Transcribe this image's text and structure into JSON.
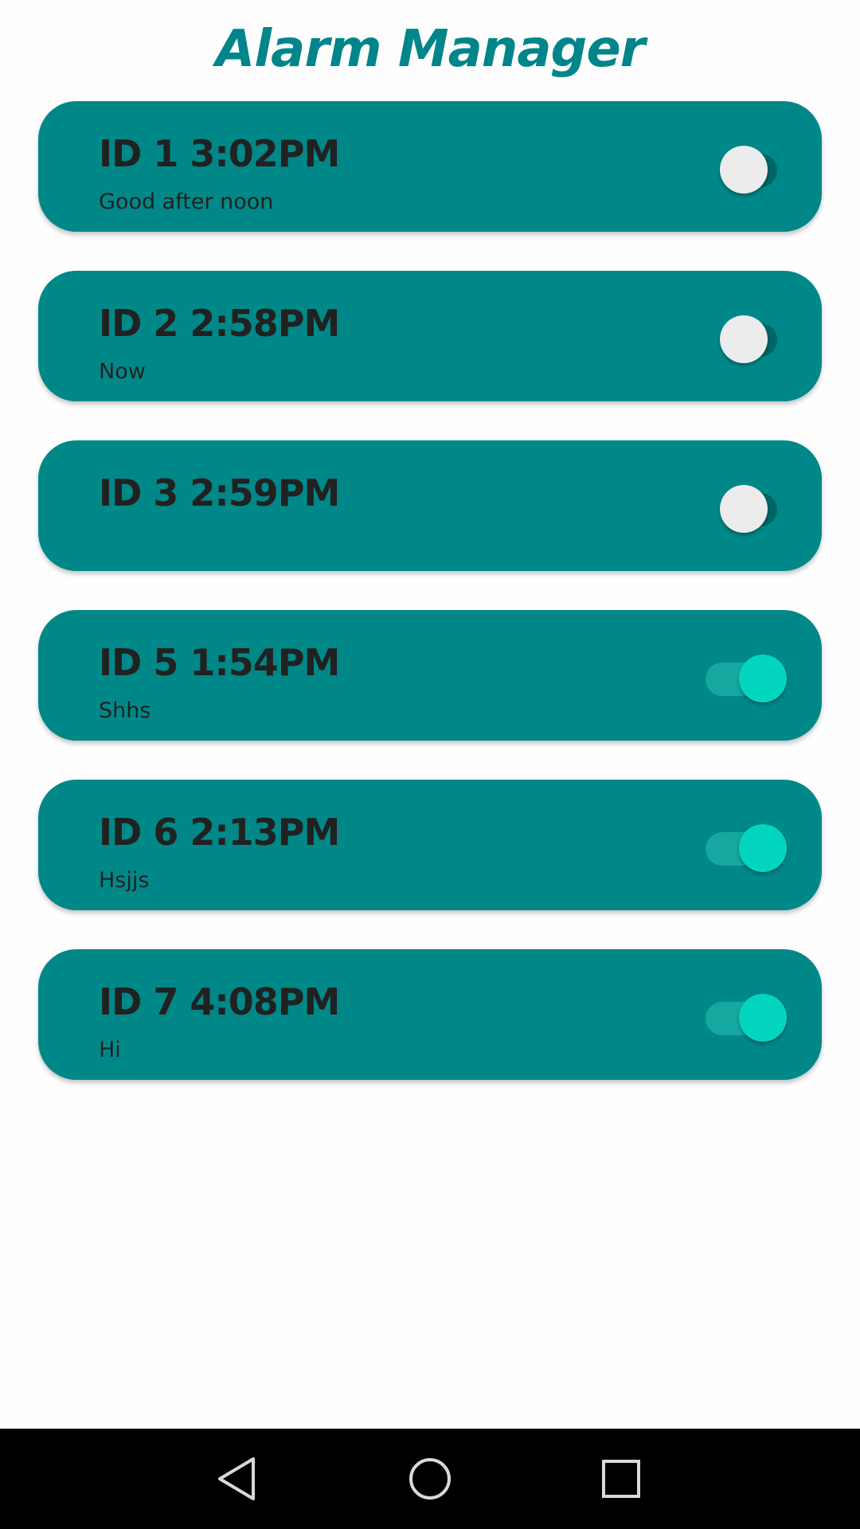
{
  "header": {
    "title": "Alarm Manager"
  },
  "colors": {
    "title": "#00858a",
    "card": "#008888",
    "text": "#212121",
    "toggle_off_thumb": "#ececec",
    "toggle_off_track": "#006565",
    "toggle_on_thumb": "#02d6be",
    "toggle_on_track": "#16a8a0"
  },
  "alarms": [
    {
      "time": "ID 1 3:02PM",
      "label": "Good after noon",
      "enabled": false
    },
    {
      "time": "ID 2 2:58PM",
      "label": "Now",
      "enabled": false
    },
    {
      "time": "ID 3 2:59PM",
      "label": "",
      "enabled": false
    },
    {
      "time": "ID 5 1:54PM",
      "label": "Shhs",
      "enabled": true
    },
    {
      "time": "ID 6 2:13PM",
      "label": "Hsjjs",
      "enabled": true
    },
    {
      "time": "ID 7 4:08PM",
      "label": "Hi",
      "enabled": true
    }
  ],
  "nav": {
    "back_icon": "triangle-back-icon",
    "home_icon": "circle-home-icon",
    "recents_icon": "square-recents-icon"
  }
}
